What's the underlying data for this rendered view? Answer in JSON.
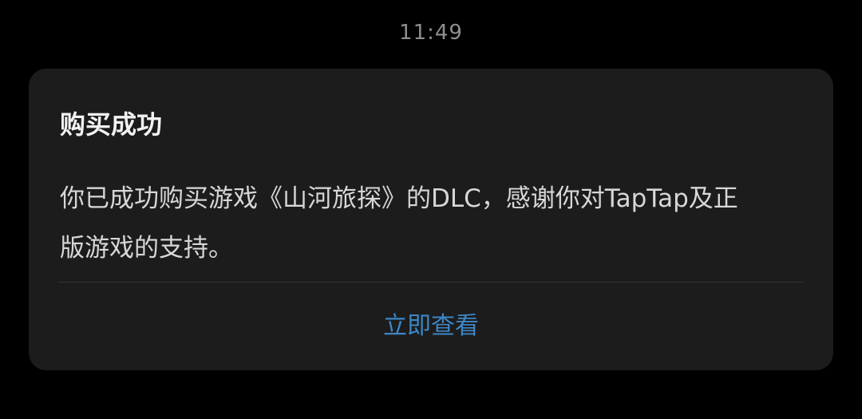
{
  "status_bar": {
    "time": "11:49"
  },
  "dialog": {
    "title": "购买成功",
    "message": "你已成功购买游戏《山河旅探》的DLC，感谢你对TapTap及正版游戏的支持。",
    "action_label": "立即查看"
  },
  "colors": {
    "background": "#000000",
    "dialog_background": "#1c1c1c",
    "title_text": "#f2f2f2",
    "body_text": "#d7d7d7",
    "action_text": "#3d86c6",
    "divider": "#333333",
    "status_text": "#8e8e8e"
  }
}
